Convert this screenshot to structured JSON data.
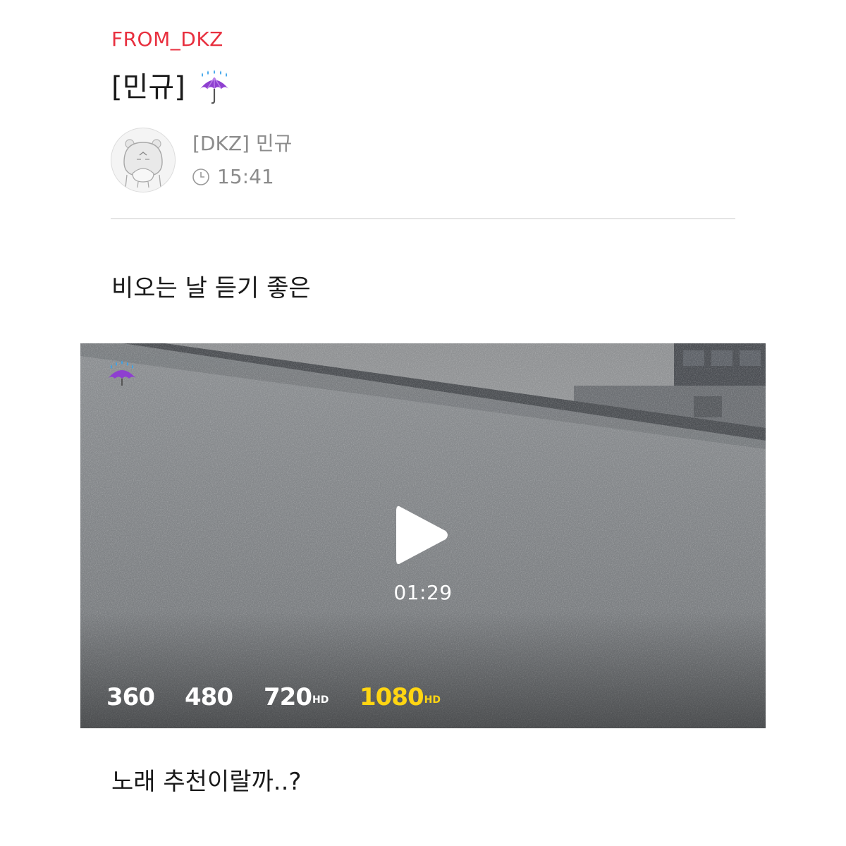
{
  "post": {
    "board": "FROM_DKZ",
    "title": "[민규]",
    "title_emoji": "umbrella-with-rain-drops",
    "author": {
      "name": "[DKZ] 민규",
      "time": "15:41",
      "avatar": "default-character-avatar"
    },
    "body": {
      "paragraph_1": "비오는 날 듣기 좋은",
      "paragraph_2": "노래 추천이랄까..?"
    }
  },
  "video": {
    "overlay_emoji": "umbrella-with-rain-drops",
    "duration": "01:29",
    "qualities": [
      {
        "label": "360",
        "hd": ""
      },
      {
        "label": "480",
        "hd": ""
      },
      {
        "label": "720",
        "hd": "HD"
      },
      {
        "label": "1080",
        "hd": "HD"
      }
    ],
    "selected_quality": "1080",
    "colors": {
      "selected_quality": "#ffd512",
      "board_label": "#e8303f"
    }
  }
}
